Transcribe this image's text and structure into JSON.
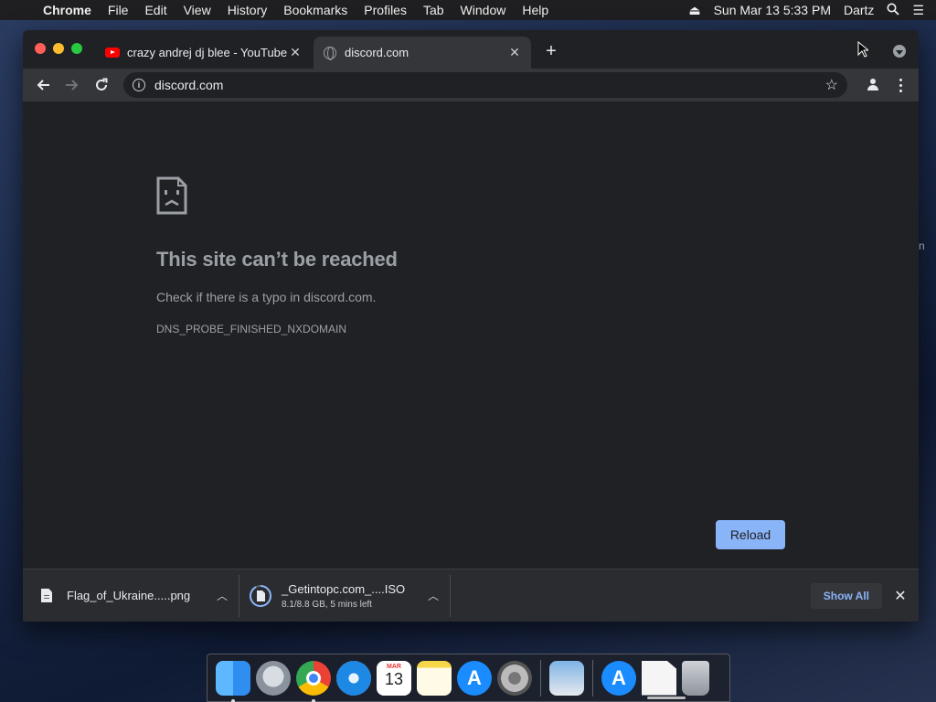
{
  "menubar": {
    "app": "Chrome",
    "items": [
      "File",
      "Edit",
      "View",
      "History",
      "Bookmarks",
      "Profiles",
      "Tab",
      "Window",
      "Help"
    ],
    "datetime": "Sun Mar 13  5:33 PM",
    "user": "Dartz"
  },
  "desktop": {
    "edge_text": "n"
  },
  "tabs": [
    {
      "title": "crazy andrej dj blee - YouTube",
      "favicon": "youtube-icon",
      "active": false
    },
    {
      "title": "discord.com",
      "favicon": "globe-icon",
      "active": true
    }
  ],
  "toolbar": {
    "url": "discord.com"
  },
  "error": {
    "title": "This site can’t be reached",
    "hint": "Check if there is a typo in discord.com.",
    "code": "DNS_PROBE_FINISHED_NXDOMAIN",
    "reload_label": "Reload"
  },
  "downloads": {
    "items": [
      {
        "name": "Flag_of_Ukraine.....png"
      },
      {
        "name": "_Getintopc.com_....ISO",
        "status": "8.1/8.8 GB, 5 mins left",
        "progress": 0.92
      }
    ],
    "show_all_label": "Show All"
  },
  "dock": {
    "apps": [
      "finder-icon",
      "launchpad-icon",
      "chrome-icon",
      "safari-icon",
      "calendar-icon",
      "notes-icon",
      "app-store-icon",
      "system-preferences-icon",
      "preview-icon",
      "app-store-icon",
      "document-icon",
      "trash-icon"
    ],
    "calendar": {
      "month": "MAR",
      "day": "13"
    }
  },
  "colors": {
    "accent": "#8ab4f8",
    "page_bg": "#202124",
    "toolbar_bg": "#35363a"
  }
}
